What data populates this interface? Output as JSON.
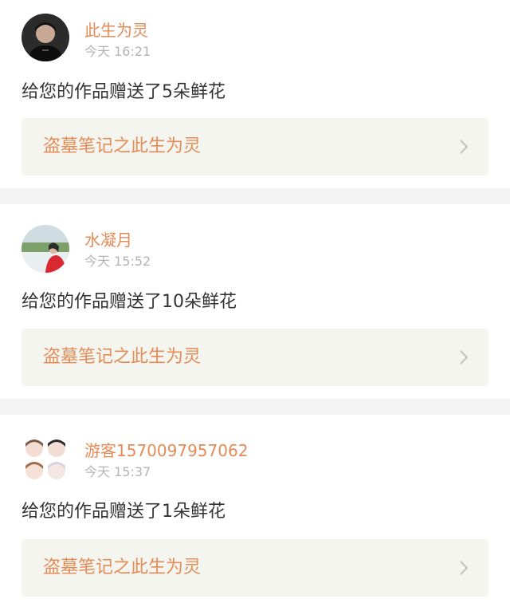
{
  "notifications": [
    {
      "user_name": "此生为灵",
      "time": "今天 16:21",
      "message": "给您的作品赠送了5朵鲜花",
      "work_title": "盗墓笔记之此生为灵",
      "avatar_icon": "avatar-dark-portrait"
    },
    {
      "user_name": "水凝月",
      "time": "今天 15:52",
      "message": "给您的作品赠送了10朵鲜花",
      "work_title": "盗墓笔记之此生为灵",
      "avatar_icon": "avatar-landscape-portrait"
    },
    {
      "user_name": "游客1570097957062",
      "time": "今天 15:37",
      "message": "给您的作品赠送了1朵鲜花",
      "work_title": "盗墓笔记之此生为灵",
      "avatar_icon": "avatar-cartoon-group"
    }
  ],
  "colors": {
    "accent": "#e58b57",
    "time_gray": "#b4b4b4",
    "card_bg": "#f5f5ef",
    "divider_bg": "#f3f3f3"
  }
}
